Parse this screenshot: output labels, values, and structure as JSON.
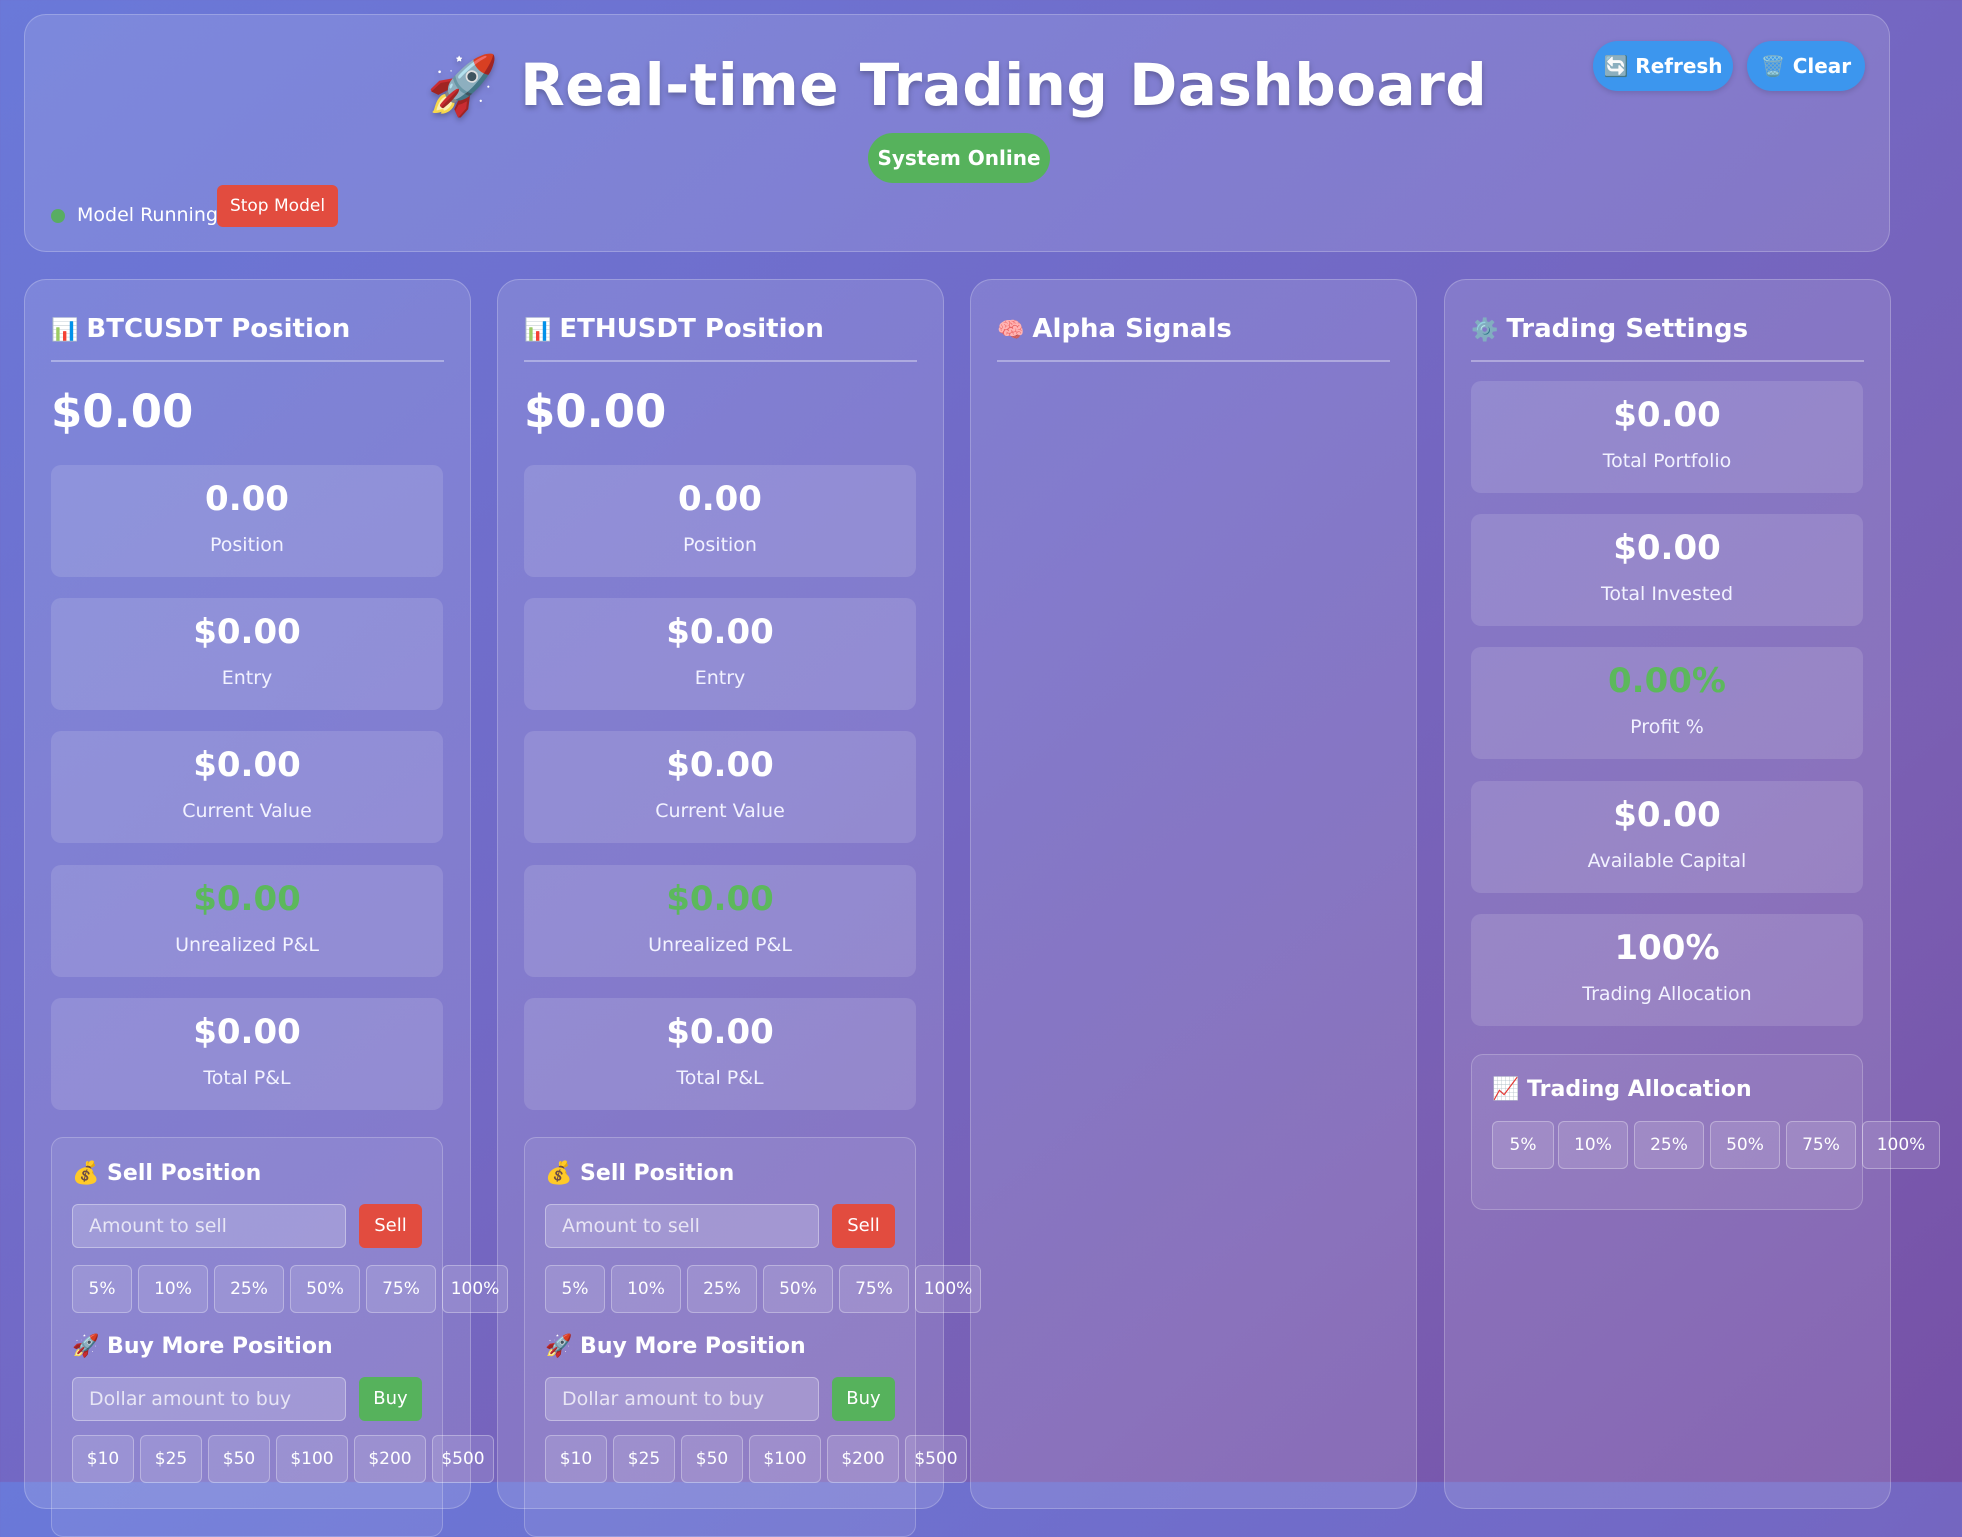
{
  "header": {
    "title": "🚀 Real-time Trading Dashboard",
    "status": "System Online",
    "refresh_label": "🔄 Refresh",
    "clear_label": "🗑️ Clear",
    "model_status": "Model Running",
    "stop_label": "Stop Model"
  },
  "btc": {
    "title": "BTCUSDT Position",
    "icon": "📊",
    "big_value": "$0.00",
    "stats": [
      {
        "value": "0.00",
        "label": "Position"
      },
      {
        "value": "$0.00",
        "label": "Entry"
      },
      {
        "value": "$0.00",
        "label": "Current Value"
      },
      {
        "value": "$0.00",
        "label": "Unrealized P&L"
      },
      {
        "value": "$0.00",
        "label": "Total P&L"
      }
    ],
    "sell_title": "💰 Sell Position",
    "sell_placeholder": "Amount to sell",
    "sell_label": "Sell",
    "sell_pcts": [
      "5%",
      "10%",
      "25%",
      "50%",
      "75%",
      "100%"
    ],
    "buy_title": "🚀 Buy More Position",
    "buy_placeholder": "Dollar amount to buy",
    "buy_label": "Buy",
    "buy_amounts": [
      "$10",
      "$25",
      "$50",
      "$100",
      "$200",
      "$500"
    ]
  },
  "eth": {
    "title": "ETHUSDT Position",
    "icon": "📊",
    "big_value": "$0.00",
    "stats": [
      {
        "value": "0.00",
        "label": "Position"
      },
      {
        "value": "$0.00",
        "label": "Entry"
      },
      {
        "value": "$0.00",
        "label": "Current Value"
      },
      {
        "value": "$0.00",
        "label": "Unrealized P&L"
      },
      {
        "value": "$0.00",
        "label": "Total P&L"
      }
    ],
    "sell_title": "💰 Sell Position",
    "sell_placeholder": "Amount to sell",
    "sell_label": "Sell",
    "sell_pcts": [
      "5%",
      "10%",
      "25%",
      "50%",
      "75%",
      "100%"
    ],
    "buy_title": "🚀 Buy More Position",
    "buy_placeholder": "Dollar amount to buy",
    "buy_label": "Buy",
    "buy_amounts": [
      "$10",
      "$25",
      "$50",
      "$100",
      "$200",
      "$500"
    ]
  },
  "alpha": {
    "title": "Alpha Signals",
    "icon": "🧠"
  },
  "settings": {
    "title": "Trading Settings",
    "icon": "⚙️",
    "stats": [
      {
        "value": "$0.00",
        "label": "Total Portfolio"
      },
      {
        "value": "$0.00",
        "label": "Total Invested"
      },
      {
        "value": "0.00%",
        "label": "Profit %"
      },
      {
        "value": "$0.00",
        "label": "Available Capital"
      },
      {
        "value": "100%",
        "label": "Trading Allocation"
      }
    ],
    "alloc_title": "📈 Trading Allocation",
    "alloc_pcts": [
      "5%",
      "10%",
      "25%",
      "50%",
      "75%",
      "100%"
    ]
  },
  "colors": {
    "positive": "#5cb85c",
    "danger": "#e24c3f",
    "primary": "#3c96ee"
  }
}
